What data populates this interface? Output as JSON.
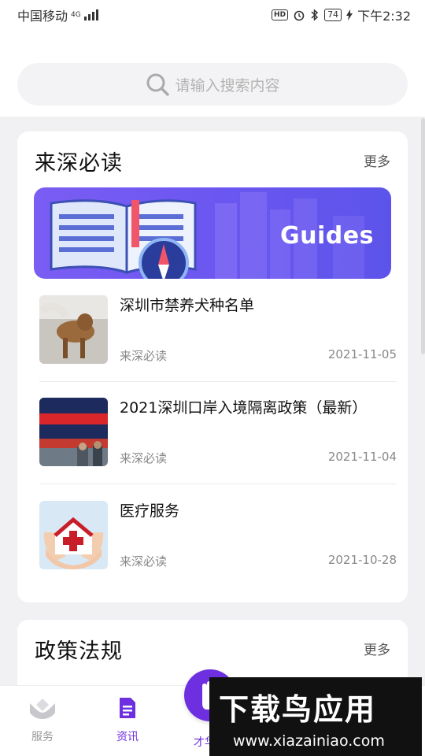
{
  "status_bar": {
    "carrier": "中国移动",
    "network": "4G",
    "hd": "HD",
    "battery": "74",
    "time": "下午2:32"
  },
  "search": {
    "placeholder": "请输入搜索内容"
  },
  "section_must_read": {
    "title": "来深必读",
    "more": "更多",
    "banner_text": "Guides",
    "items": [
      {
        "title": "深圳市禁养犬种名单",
        "category": "来深必读",
        "date": "2021-11-05"
      },
      {
        "title": "2021深圳口岸入境隔离政策（最新）",
        "category": "来深必读",
        "date": "2021-11-04"
      },
      {
        "title": "医疗服务",
        "category": "来深必读",
        "date": "2021-10-28"
      }
    ]
  },
  "section_policy": {
    "title": "政策法规",
    "more": "更多"
  },
  "bottom_nav": {
    "services": "服务",
    "news": "资讯",
    "talent": "才华"
  },
  "watermark": {
    "title": "下载鸟应用",
    "url": "www.xiazainiao.com"
  },
  "colors": {
    "accent": "#6d2fe0",
    "banner": "#6a56f0"
  }
}
